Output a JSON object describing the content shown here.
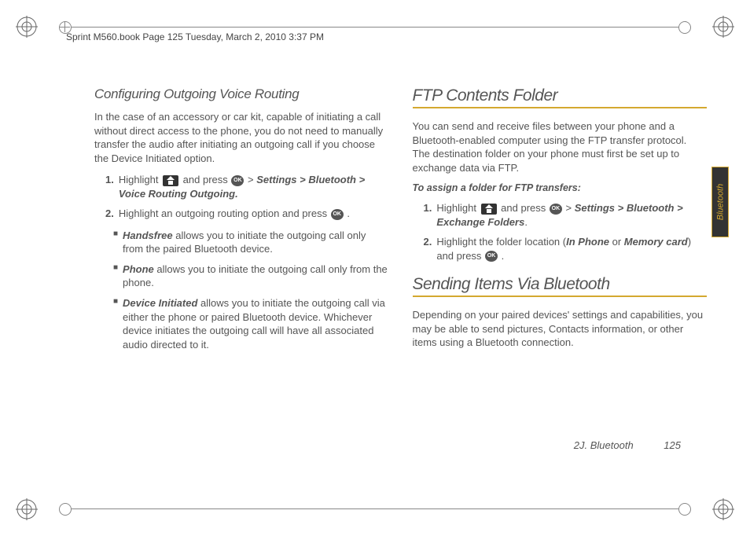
{
  "header": {
    "text": "Sprint M560.book  Page 125  Tuesday, March 2, 2010  3:37 PM"
  },
  "left_column": {
    "subheading": "Configuring Outgoing Voice Routing",
    "intro": "In the case of an accessory or car kit, capable of initiating a call without direct access to the phone, you do not need to manually transfer the audio after initiating an outgoing call if you choose the Device Initiated option.",
    "steps": [
      {
        "num": "1.",
        "pre": "Highlight ",
        "mid": " and press ",
        "post": " > ",
        "path": "Settings > Bluetooth > Voice Routing Outgoing."
      },
      {
        "num": "2.",
        "text_pre": "Highlight an outgoing routing option and press ",
        "text_post": " ."
      }
    ],
    "bullets": [
      {
        "label": "Handsfree",
        "text": " allows you to initiate the outgoing call only from the paired Bluetooth device."
      },
      {
        "label": "Phone",
        "text": " allows you to initiate the outgoing call only from the phone."
      },
      {
        "label": "Device Initiated",
        "text": " allows you to initiate the outgoing call via either the phone or paired Bluetooth device. Whichever device initiates the outgoing call will have all associated audio directed to it."
      }
    ]
  },
  "right_column": {
    "section1_heading": "FTP Contents Folder",
    "section1_intro": "You can send and receive files between your phone and a Bluetooth-enabled computer using the FTP transfer protocol. The destination folder on your phone must first be set up to exchange data via FTP.",
    "section1_instruction": "To assign a folder for FTP transfers:",
    "section1_steps": [
      {
        "num": "1.",
        "pre": "Highlight ",
        "mid": " and press ",
        "post": " > ",
        "path": "Settings > Bluetooth > Exchange Folders"
      },
      {
        "num": "2.",
        "text_pre": "Highlight the folder location (",
        "opt1": "In Phone",
        "or": " or ",
        "opt2": "Memory card",
        "text_post": ") and press "
      }
    ],
    "section2_heading": "Sending Items Via Bluetooth",
    "section2_intro": "Depending on your paired devices' settings and capabilities, you may be able to send pictures, Contacts information, or other items using a Bluetooth connection.",
    "side_tab": "Bluetooth"
  },
  "footer": {
    "chapter": "2J. Bluetooth",
    "page": "125"
  },
  "icons": {
    "ok_label": "OK"
  }
}
